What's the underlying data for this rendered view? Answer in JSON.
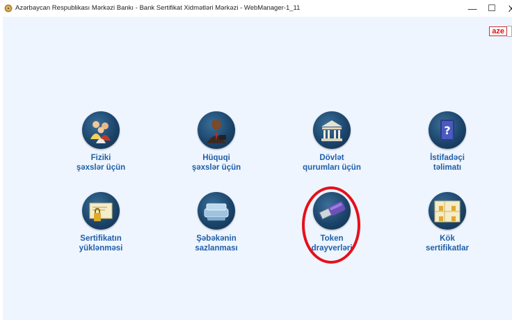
{
  "window": {
    "title": "Azərbaycan Respublikası Mərkəzi Bankı - Bank Sertifikat Xidmətləri Mərkəzi - WebManager-1_11",
    "controls": {
      "minimize": "—",
      "maximize": "☐",
      "close": "X"
    }
  },
  "language": {
    "selected": "aze"
  },
  "tiles": [
    {
      "line1": "Fiziki",
      "line2": "şəxslər üçün",
      "icon": "individuals-icon"
    },
    {
      "line1": "Hüquqi",
      "line2": "şəxslər üçün",
      "icon": "legal-entity-icon"
    },
    {
      "line1": "Dövlət",
      "line2": "qurumları üçün",
      "icon": "government-building-icon"
    },
    {
      "line1": "İstifadəçi",
      "line2": "təlimatı",
      "icon": "user-manual-icon"
    },
    {
      "line1": "Sertifikatın",
      "line2": "yüklənməsi",
      "icon": "certificate-download-icon"
    },
    {
      "line1": "Şəbəkənin",
      "line2": "sazlanması",
      "icon": "network-settings-icon"
    },
    {
      "line1": "Token",
      "line2": "drayverləri",
      "icon": "usb-token-icon"
    },
    {
      "line1": "Kök",
      "line2": "sertifikatlar",
      "icon": "root-certificates-icon"
    }
  ],
  "colors": {
    "label": "#1f5fa8",
    "background": "#eef5fe",
    "highlight": "#e5101a",
    "language_text": "#e01010"
  }
}
